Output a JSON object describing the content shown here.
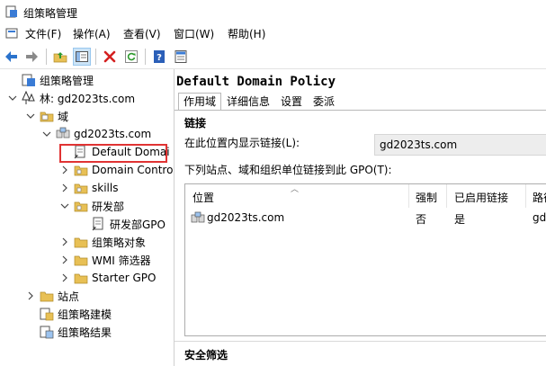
{
  "window": {
    "title": "组策略管理"
  },
  "menu": {
    "items": [
      "文件(F)",
      "操作(A)",
      "查看(V)",
      "窗口(W)",
      "帮助(H)"
    ]
  },
  "toolbar": {
    "buttons": [
      "back-icon",
      "forward-icon",
      "up-folder-icon",
      "show-hide-tree-icon",
      "delete-icon",
      "refresh-icon",
      "help-icon",
      "properties-icon"
    ]
  },
  "tree": {
    "root": "组策略管理",
    "forest": "林: gd2023ts.com",
    "domains": "域",
    "domain": "gd2023ts.com",
    "gpo_link_default": "Default Domai",
    "domain_controllers": "Domain Contro",
    "skills": "skills",
    "ou_rd": "研发部",
    "ou_rd_gpo": "研发部GPO",
    "gpo_objects": "组策略对象",
    "wmi_filters": "WMI 筛选器",
    "starter_gpo": "Starter GPO",
    "sites": "站点",
    "gp_modeling": "组策略建模",
    "gp_results": "组策略结果"
  },
  "detail": {
    "title": "Default Domain Policy",
    "tabs": [
      "作用域",
      "详细信息",
      "设置",
      "委派"
    ],
    "links_header": "链接",
    "display_links_label": "在此位置内显示链接(L):",
    "display_links_value": "gd2023ts.com",
    "table_caption": "下列站点、域和组织单位链接到此 GPO(T):",
    "columns": [
      "位置",
      "强制",
      "已启用链接",
      "路径"
    ],
    "rows": [
      {
        "location": "gd2023ts.com",
        "enforced": "否",
        "link_enabled": "是",
        "path": "gd"
      }
    ],
    "security_header": "安全筛选"
  },
  "colors": {
    "selection_box": "#e03333",
    "accent": "#1e6ec8"
  }
}
